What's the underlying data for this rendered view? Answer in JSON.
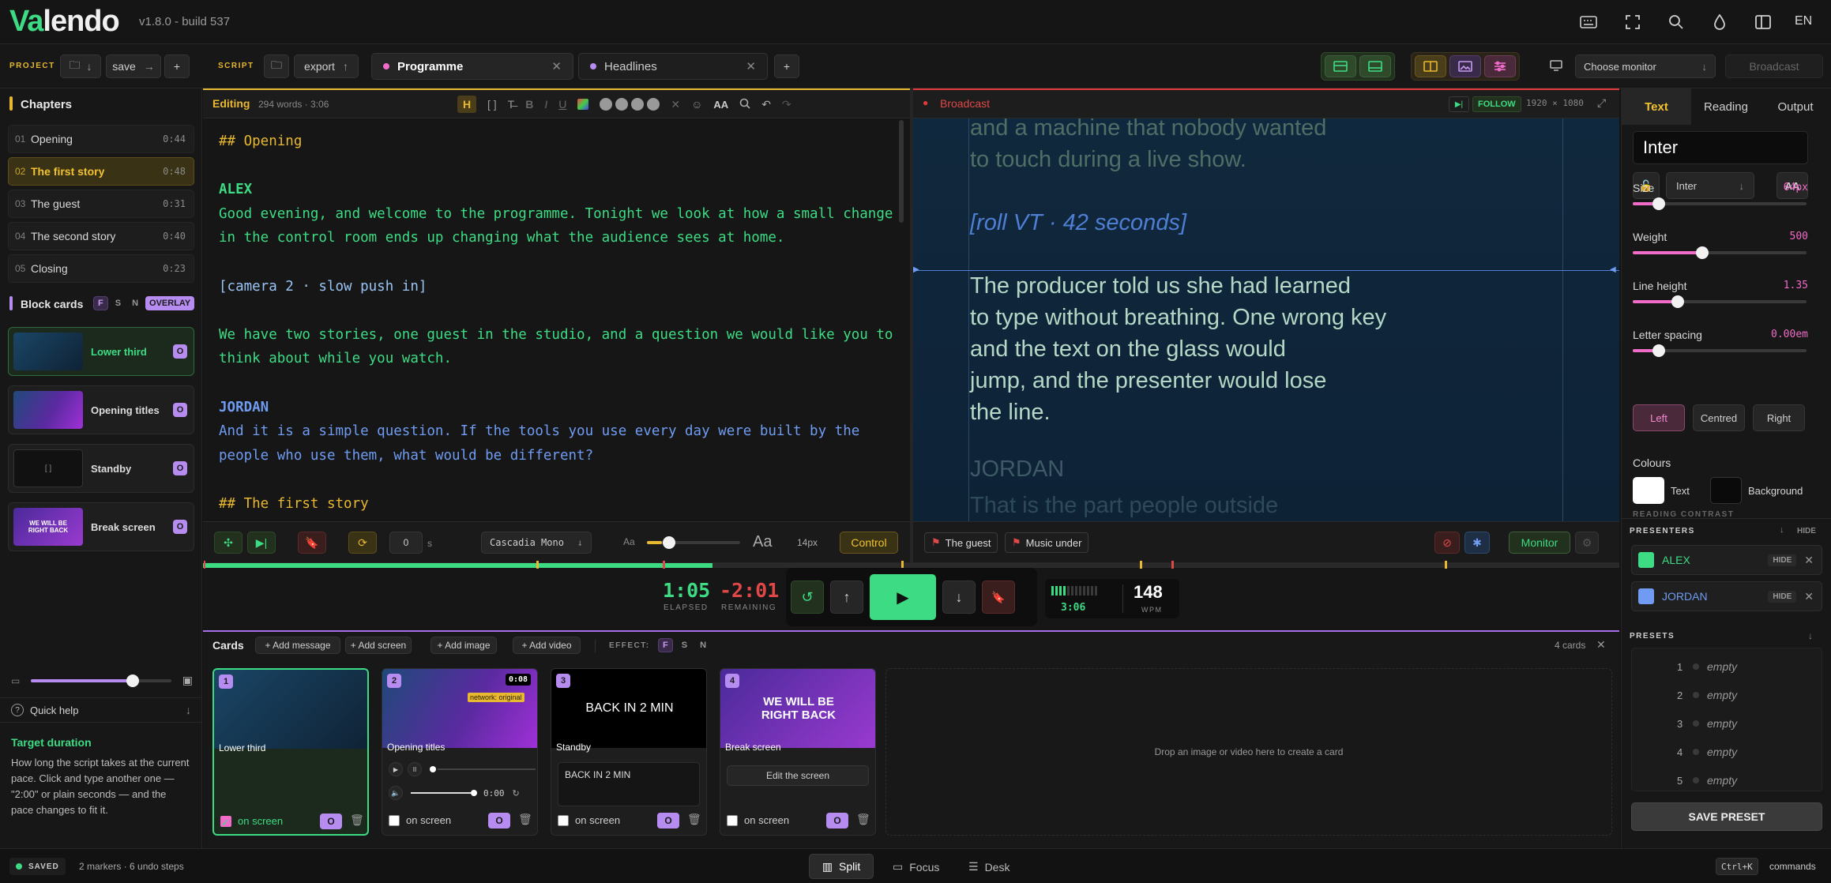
{
  "app": {
    "name_a": "Va",
    "name_b": "lendo",
    "version": "v1.8.0 - build 537",
    "lang": "EN"
  },
  "toolbar": {
    "project_label": "PROJECT",
    "save": "save",
    "script_label": "SCRIPT",
    "export": "export",
    "tabs": [
      {
        "label": "Programme"
      },
      {
        "label": "Headlines"
      }
    ],
    "monitor_select": "Choose monitor",
    "broadcast": "Broadcast"
  },
  "sidebar": {
    "chapters_title": "Chapters",
    "chapters": [
      {
        "num": "01",
        "title": "Opening",
        "dur": "0:44"
      },
      {
        "num": "02",
        "title": "The first story",
        "dur": "0:48"
      },
      {
        "num": "03",
        "title": "The guest",
        "dur": "0:31"
      },
      {
        "num": "04",
        "title": "The second story",
        "dur": "0:40"
      },
      {
        "num": "05",
        "title": "Closing",
        "dur": "0:23"
      }
    ],
    "block_title": "Block cards",
    "pills": [
      "F",
      "S",
      "N"
    ],
    "overlay": "OVERLAY",
    "blocks": [
      {
        "label": "Lower third",
        "badge": "O"
      },
      {
        "label": "Opening titles",
        "badge": "O"
      },
      {
        "label": "Standby",
        "badge": "O",
        "thumb": "[ ]"
      },
      {
        "label": "Break screen",
        "badge": "O",
        "thumb": "WE WILL BE RIGHT BACK"
      }
    ],
    "quick_help": "Quick help",
    "help_title": "Target duration",
    "help_text": "How long the script takes at the current pace. Click and type another one — \"2:00\" or plain seconds — and the pace changes to fit it."
  },
  "editor": {
    "title": "Editing",
    "meta": "294 words · 3:06",
    "lines": [
      {
        "cls": "md",
        "text": "## Opening"
      },
      {
        "cls": "",
        "text": ""
      },
      {
        "cls": "sp-a",
        "text": "ALEX"
      },
      {
        "cls": "sp-a-t",
        "text": "Good evening, and welcome to the programme. Tonight we look at how a small change"
      },
      {
        "cls": "sp-a-t",
        "text": "in the control room ends up changing what the audience sees at home."
      },
      {
        "cls": "",
        "text": ""
      },
      {
        "cls": "cue",
        "text": "[camera 2 · slow push in]"
      },
      {
        "cls": "",
        "text": ""
      },
      {
        "cls": "plain",
        "text": "We have two stories, one guest in the studio, and a question we would like you to"
      },
      {
        "cls": "plain",
        "text": "think about while you watch."
      },
      {
        "cls": "",
        "text": ""
      },
      {
        "cls": "sp-j",
        "text": "JORDAN"
      },
      {
        "cls": "sp-j-t",
        "text": "And it is a simple question. If the tools you use every day were built by the"
      },
      {
        "cls": "sp-j-t",
        "text": "people who use them, what would be different?"
      },
      {
        "cls": "",
        "text": ""
      },
      {
        "cls": "md",
        "text": "## The first story"
      }
    ],
    "footer": {
      "offset": "0",
      "offset_unit": "s",
      "font": "Cascadia Mono",
      "aa_small": "Aa",
      "aa_big": "Aa",
      "size": "14px",
      "control": "Control"
    }
  },
  "broadcast": {
    "title": "Broadcast",
    "follow": "FOLLOW",
    "resolution": "1920 × 1080",
    "lines_above": [
      "and a machine that nobody wanted",
      "to touch during a live show."
    ],
    "cue": "[roll VT · 42 seconds]",
    "current": [
      "The producer told us she had learned",
      "to type without breathing. One wrong key",
      "and the text on the glass would",
      "jump, and the presenter would lose",
      "the line."
    ],
    "next_speaker": "JORDAN",
    "next_line": "That is the part people outside",
    "tags": [
      "The guest",
      "Music under"
    ],
    "monitor": "Monitor"
  },
  "right": {
    "tabs": [
      "Text",
      "Reading",
      "Output"
    ],
    "font_display": "Inter",
    "font_select": "Inter",
    "aa": "AA",
    "sliders": [
      {
        "label": "Size",
        "value": "64px",
        "frac": 0.15
      },
      {
        "label": "Weight",
        "value": "500",
        "frac": 0.4
      },
      {
        "label": "Line height",
        "value": "1.35",
        "frac": 0.26
      },
      {
        "label": "Letter spacing",
        "value": "0.00em",
        "frac": 0.15
      }
    ],
    "align": [
      "Left",
      "Centred",
      "Right"
    ],
    "colours_title": "Colours",
    "text_label": "Text",
    "bg_label": "Background",
    "reading_contrast": "READING CONTRAST",
    "presenters_title": "PRESENTERS",
    "hide": "HIDE",
    "presenters": [
      {
        "name": "ALEX",
        "color": "#3ddc84",
        "hide": "HIDE"
      },
      {
        "name": "JORDAN",
        "color": "#6f9cf2",
        "hide": "HIDE"
      }
    ],
    "presets_title": "PRESETS",
    "presets": [
      {
        "n": "1",
        "v": "empty"
      },
      {
        "n": "2",
        "v": "empty"
      },
      {
        "n": "3",
        "v": "empty"
      },
      {
        "n": "4",
        "v": "empty"
      },
      {
        "n": "5",
        "v": "empty"
      }
    ],
    "save_preset": "SAVE PRESET"
  },
  "transport": {
    "elapsed": "1:05",
    "elapsed_label": "ELAPSED",
    "remaining": "-2:01",
    "remaining_label": "REMAINING",
    "duration": "3:06",
    "wpm": "148",
    "wpm_label": "WPM",
    "progress": 0.36
  },
  "cards": {
    "title": "Cards",
    "add_message": "+ Add message",
    "add_screen": "+ Add screen",
    "add_image": "+ Add image",
    "add_video": "+ Add video",
    "effect": "EFFECT:",
    "count": "4 cards",
    "items": [
      {
        "num": "1",
        "title": "Lower third",
        "on": "on screen",
        "badge": "O"
      },
      {
        "num": "2",
        "title": "Opening titles",
        "time": "0:08",
        "tag": "network: original",
        "on": "on screen",
        "badge": "O",
        "vtime": "0:00"
      },
      {
        "num": "3",
        "title": "Standby",
        "big": "BACK IN 2 MIN",
        "field": "BACK IN 2 MIN",
        "on": "on screen",
        "badge": "O"
      },
      {
        "num": "4",
        "title": "Break screen",
        "big": "WE WILL BE RIGHT BACK",
        "edit": "Edit the screen",
        "on": "on screen",
        "badge": "O"
      }
    ],
    "drop": "Drop an image or video here to create a card"
  },
  "bottom": {
    "saved": "SAVED",
    "status": "2 markers · 6 undo steps",
    "views": [
      "Split",
      "Focus",
      "Desk"
    ],
    "shortcut": "Ctrl+K",
    "commands": "commands"
  }
}
